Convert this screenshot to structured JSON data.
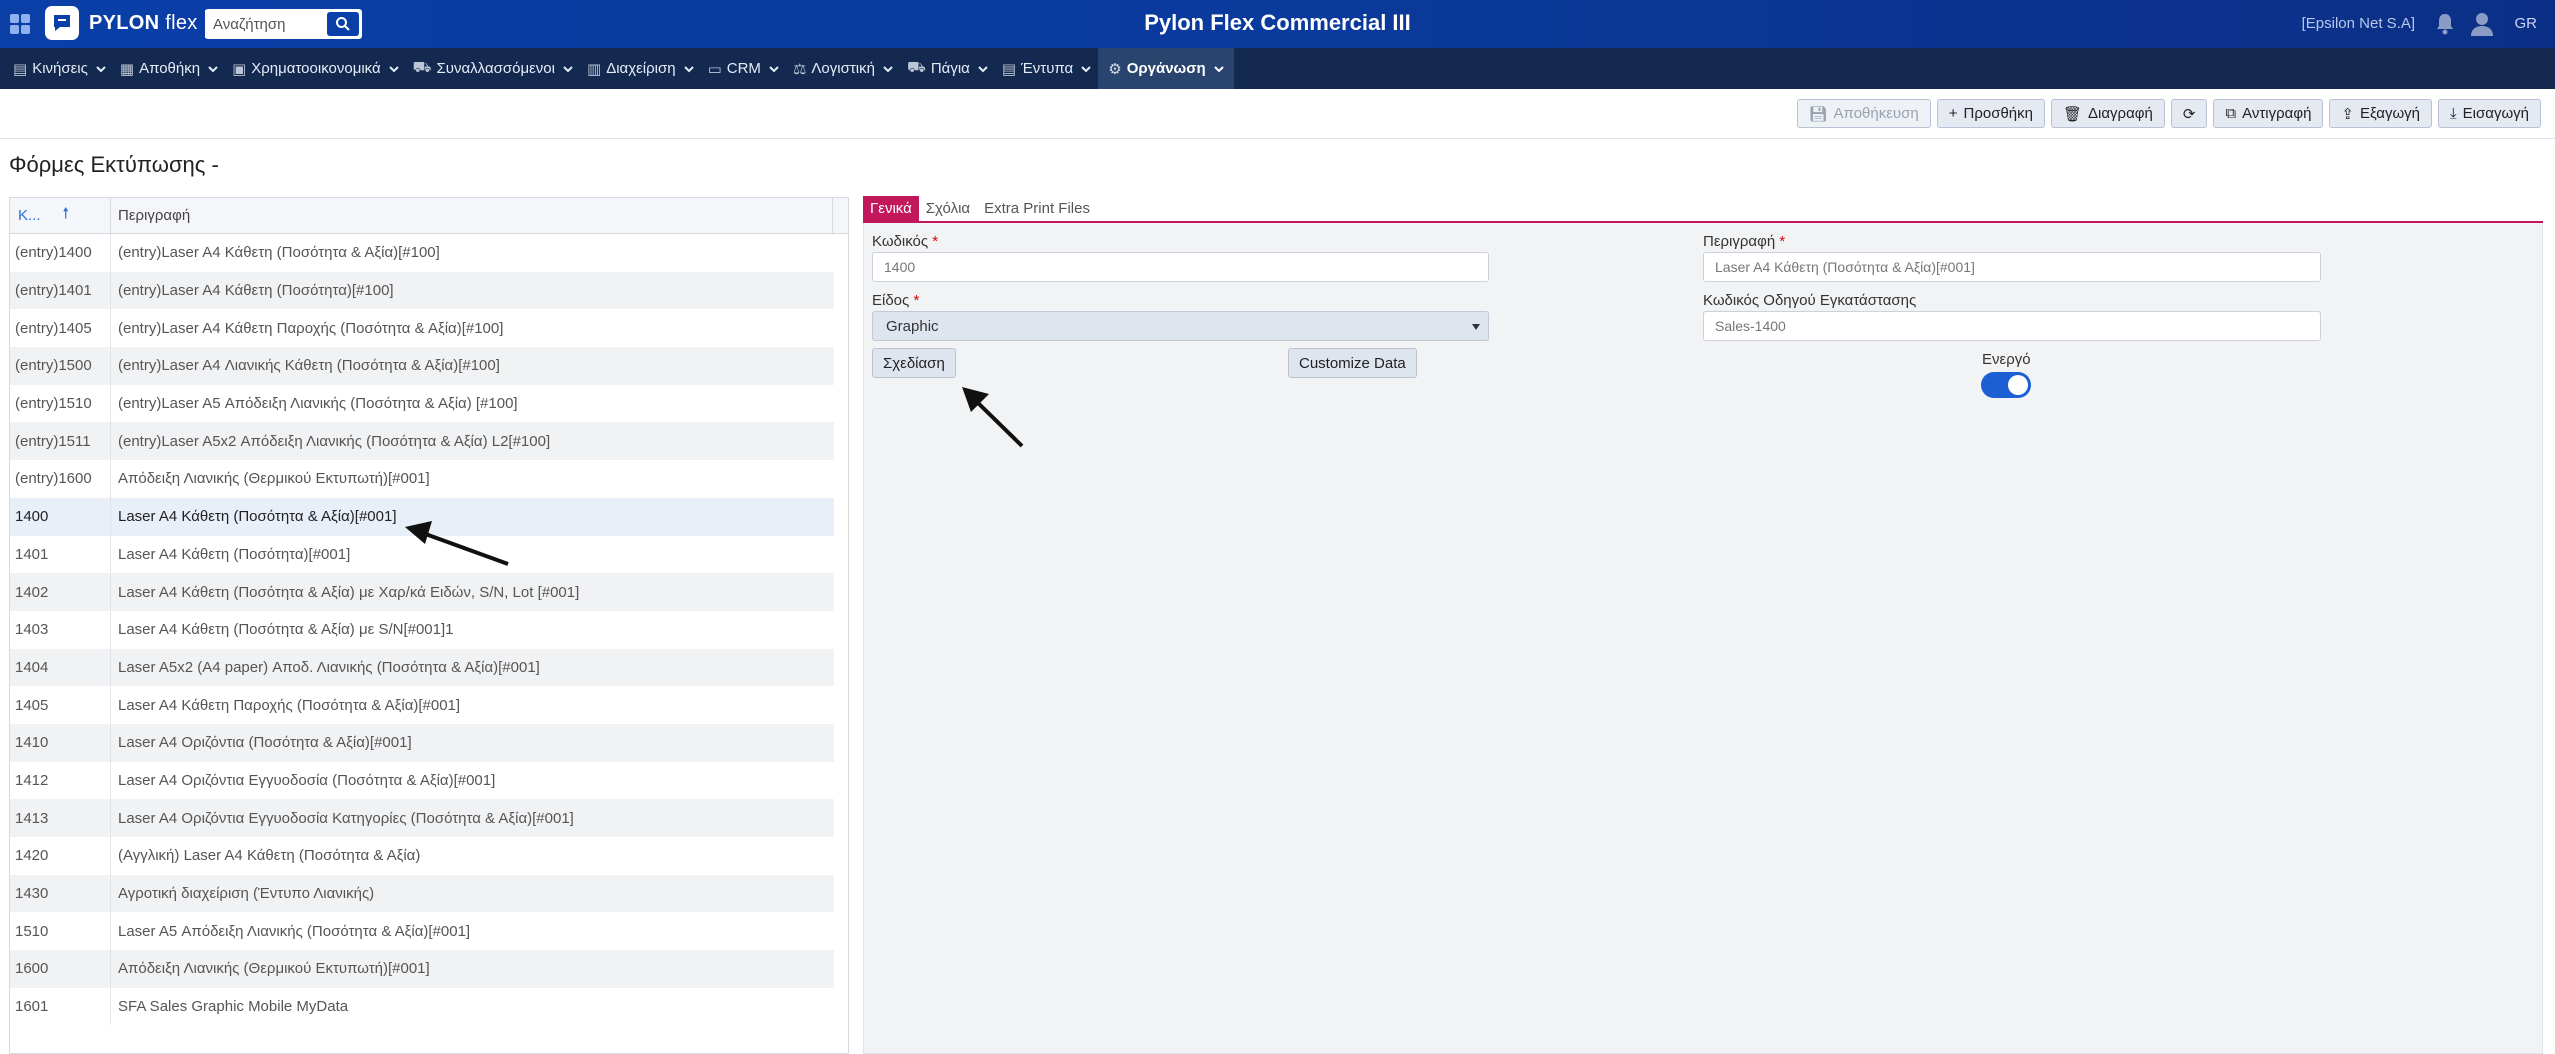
{
  "header": {
    "logo_text": "PYLON",
    "logo_text_2": " flex",
    "search_placeholder": "Αναζήτηση",
    "app_title": "Pylon Flex Commercial III",
    "company": "[Epsilon Net S.A]",
    "language": "GR"
  },
  "menu": [
    {
      "label": "Κινήσεις",
      "icon": "document-icon"
    },
    {
      "label": "Αποθήκη",
      "icon": "warehouse-icon"
    },
    {
      "label": "Χρηματοοικονομικά",
      "icon": "money-icon"
    },
    {
      "label": "Συναλλασσόμενοι",
      "icon": "truck-icon"
    },
    {
      "label": "Διαχείριση",
      "icon": "book-icon"
    },
    {
      "label": "CRM",
      "icon": "id-card-icon"
    },
    {
      "label": "Λογιστική",
      "icon": "scale-icon"
    },
    {
      "label": "Πάγια",
      "icon": "truck-icon"
    },
    {
      "label": "Έντυπα",
      "icon": "print-icon"
    },
    {
      "label": "Οργάνωση",
      "icon": "gear-icon"
    }
  ],
  "toolbar": {
    "save": "Αποθήκευση",
    "add": "Προσθήκη",
    "delete": "Διαγραφή",
    "copy": "Αντιγραφή",
    "export": "Εξαγωγή",
    "import": "Εισαγωγή"
  },
  "page_title": "Φόρμες Εκτύπωσης -",
  "grid": {
    "col_code": "Κ...",
    "col_desc": "Περιγραφή",
    "rows": [
      {
        "code": "(entry)1400",
        "desc": "(entry)Laser A4 Κάθετη (Ποσότητα & Αξία)[#100]"
      },
      {
        "code": "(entry)1401",
        "desc": "(entry)Laser A4 Κάθετη (Ποσότητα)[#100]"
      },
      {
        "code": "(entry)1405",
        "desc": "(entry)Laser A4 Κάθετη Παροχής (Ποσότητα & Αξία)[#100]"
      },
      {
        "code": "(entry)1500",
        "desc": "(entry)Laser A4 Λιανικής Κάθετη (Ποσότητα & Αξία)[#100]"
      },
      {
        "code": "(entry)1510",
        "desc": "(entry)Laser A5 Απόδειξη Λιανικής (Ποσότητα & Αξία) [#100]"
      },
      {
        "code": "(entry)1511",
        "desc": "(entry)Laser A5x2 Απόδειξη Λιανικής (Ποσότητα & Αξία) L2[#100]"
      },
      {
        "code": "(entry)1600",
        "desc": "Απόδειξη Λιανικής (Θερμικού Εκτυπωτή)[#001]"
      },
      {
        "code": "1400",
        "desc": "Laser A4 Κάθετη (Ποσότητα & Αξία)[#001]"
      },
      {
        "code": "1401",
        "desc": "Laser A4 Κάθετη (Ποσότητα)[#001]"
      },
      {
        "code": "1402",
        "desc": "Laser A4 Κάθετη (Ποσότητα & Αξία) με Χαρ/κά Ειδών, S/N, Lot [#001]"
      },
      {
        "code": "1403",
        "desc": "Laser A4 Κάθετη (Ποσότητα & Αξία) με S/N[#001]1"
      },
      {
        "code": "1404",
        "desc": "Laser A5x2 (A4 paper) Αποδ. Λιανικής (Ποσότητα & Αξία)[#001]"
      },
      {
        "code": "1405",
        "desc": "Laser A4 Κάθετη Παροχής (Ποσότητα & Αξία)[#001]"
      },
      {
        "code": "1410",
        "desc": "Laser A4 Οριζόντια (Ποσότητα & Αξία)[#001]"
      },
      {
        "code": "1412",
        "desc": "Laser A4 Οριζόντια Εγγυοδοσία (Ποσότητα & Αξία)[#001]"
      },
      {
        "code": "1413",
        "desc": "Laser A4 Οριζόντια Εγγυοδοσία Κατηγορίες (Ποσότητα & Αξία)[#001]"
      },
      {
        "code": "1420",
        "desc": "(Αγγλική) Laser A4 Κάθετη (Ποσότητα & Αξία)"
      },
      {
        "code": "1430",
        "desc": "Αγροτική διαχείριση (Έντυπο Λιανικής)"
      },
      {
        "code": "1510",
        "desc": "Laser A5 Απόδειξη Λιανικής (Ποσότητα & Αξία)[#001]"
      },
      {
        "code": "1600",
        "desc": "Απόδειξη Λιανικής (Θερμικού Εκτυπωτή)[#001]"
      },
      {
        "code": "1601",
        "desc": "SFA Sales Graphic Mobile MyData"
      }
    ]
  },
  "tabs": [
    "Γενικά",
    "Σχόλια",
    "Extra Print Files"
  ],
  "form": {
    "code_label": "Κωδικός",
    "code_value": "1400",
    "desc_label": "Περιγραφή",
    "desc_value": "Laser A4 Κάθετη (Ποσότητα & Αξία)[#001]",
    "type_label": "Είδος",
    "type_value": "Graphic",
    "driver_label": "Κωδικός Οδηγού Εγκατάστασης",
    "driver_value": "Sales-1400",
    "design_button": "Σχεδίαση",
    "customize_button": "Customize Data",
    "active_label": "Ενεργό",
    "required_mark": "*"
  },
  "colors": {
    "topbar": "#0a3fa8",
    "menubar": "#13294f",
    "tab_active": "#c2185b",
    "toggle": "#1c5fd4"
  }
}
